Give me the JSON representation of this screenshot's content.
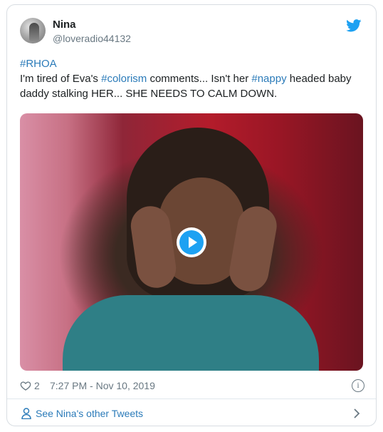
{
  "tweet": {
    "author": {
      "display_name": "Nina",
      "handle": "@loveradio44132"
    },
    "text_parts": {
      "tag_rhoa": "#RHOA",
      "p1": "I'm tired of Eva's ",
      "tag_colorism": "#colorism",
      "p2": " comments... Isn't her ",
      "tag_nappy": "#nappy",
      "p3": " headed baby daddy stalking HER... SHE NEEDS TO CALM DOWN."
    },
    "likes": "2",
    "timestamp": "7:27 PM - Nov 10, 2019",
    "info_icon": "info-icon",
    "footer_link": "See Nina's other Tweets"
  },
  "colors": {
    "link": "#2b7bb9",
    "brand": "#1da1f2",
    "muted": "#697882",
    "border": "#d8dde2"
  },
  "icons": {
    "brand": "twitter-bird-icon",
    "like": "heart-icon",
    "play": "play-icon",
    "profile": "person-icon",
    "chevron": "chevron-right-icon"
  }
}
